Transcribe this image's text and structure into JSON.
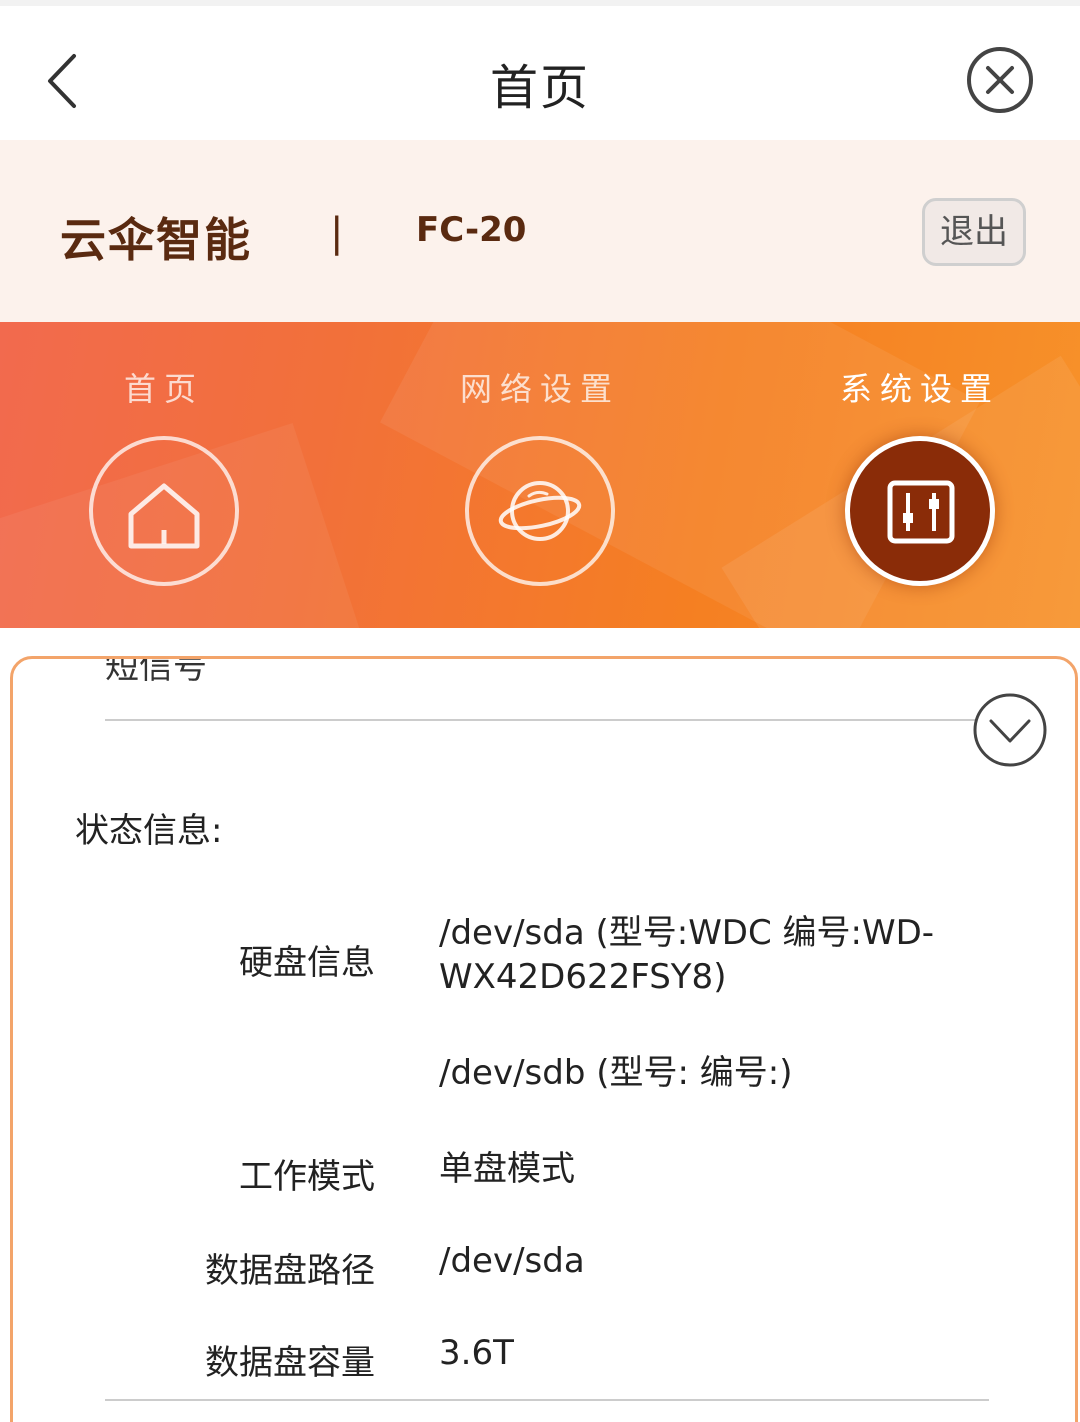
{
  "nav": {
    "title": "首页",
    "back_icon": "chevron-left-icon",
    "close_icon": "close-circle-icon"
  },
  "header": {
    "brand": "云伞智能",
    "separator": "|",
    "model": "FC-20",
    "logout_label": "退出"
  },
  "tabs": [
    {
      "label": "首页",
      "icon": "home-icon",
      "active": false
    },
    {
      "label": "网络设置",
      "icon": "planet-icon",
      "active": false
    },
    {
      "label": "系统设置",
      "icon": "sliders-icon",
      "active": true
    }
  ],
  "colors": {
    "accent": "#f57f22",
    "brand_dark": "#5a2a10",
    "active_tab": "#8a2c08",
    "card_border": "#f3a46a"
  },
  "content": {
    "clipped_label": "短信号",
    "section_title": "状态信息:",
    "rows": [
      {
        "label": "硬盘信息",
        "value_line1": "/dev/sda (型号:WDC 编号:WD-",
        "value_line2": "WX42D622FSY8)"
      },
      {
        "label": "",
        "value_line1": "/dev/sdb (型号: 编号:)"
      },
      {
        "label": "工作模式",
        "value_line1": "单盘模式"
      },
      {
        "label": "数据盘路径",
        "value_line1": "/dev/sda"
      },
      {
        "label": "数据盘容量",
        "value_line1": "3.6T"
      }
    ]
  }
}
